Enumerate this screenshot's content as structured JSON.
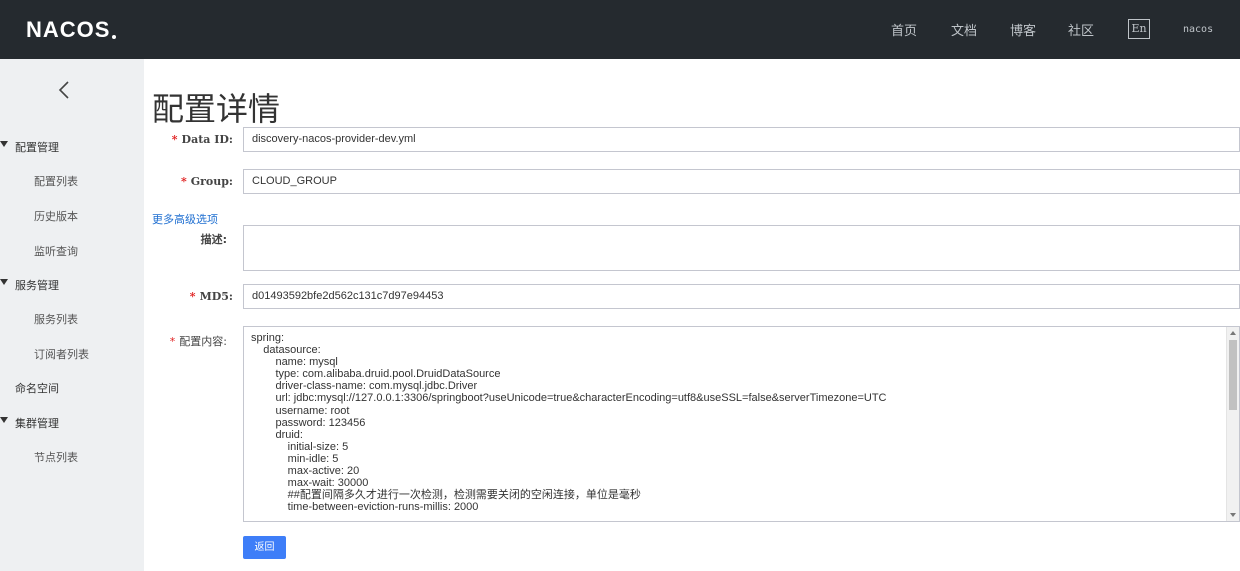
{
  "header": {
    "logo_text": "NACOS",
    "nav": [
      "首页",
      "文档",
      "博客",
      "社区"
    ],
    "lang": "En",
    "user": "nacos"
  },
  "sidebar": {
    "groups": [
      {
        "label": "配置管理",
        "items": [
          "配置列表",
          "历史版本",
          "监听查询"
        ]
      },
      {
        "label": "服务管理",
        "items": [
          "服务列表",
          "订阅者列表"
        ]
      },
      {
        "label": "命名空间"
      },
      {
        "label": "集群管理",
        "items": [
          "节点列表"
        ]
      }
    ]
  },
  "page": {
    "title": "配置详情",
    "more_options": "更多高级选项",
    "back_button": "返回"
  },
  "form": {
    "data_id": {
      "label": "Data ID:",
      "value": "discovery-nacos-provider-dev.yml"
    },
    "group": {
      "label": "Group:",
      "value": "CLOUD_GROUP"
    },
    "desc": {
      "label": "描述:",
      "value": ""
    },
    "md5": {
      "label": "MD5:",
      "value": "d01493592bfe2d562c131c7d97e94453"
    },
    "content": {
      "label": "配置内容:",
      "lines": [
        "spring:",
        "    datasource:",
        "        name: mysql",
        "        type: com.alibaba.druid.pool.DruidDataSource",
        "        driver-class-name: com.mysql.jdbc.Driver",
        "        url: jdbc:mysql://127.0.0.1:3306/springboot?useUnicode=true&characterEncoding=utf8&useSSL=false&serverTimezone=UTC",
        "        username: root",
        "        password: 123456",
        "        druid:",
        "            initial-size: 5",
        "            min-idle: 5",
        "            max-active: 20",
        "            max-wait: 30000",
        "            ##配置间隔多久才进行一次检测，检测需要关闭的空闲连接，单位是毫秒",
        "            time-between-eviction-runs-millis: 2000"
      ]
    }
  }
}
